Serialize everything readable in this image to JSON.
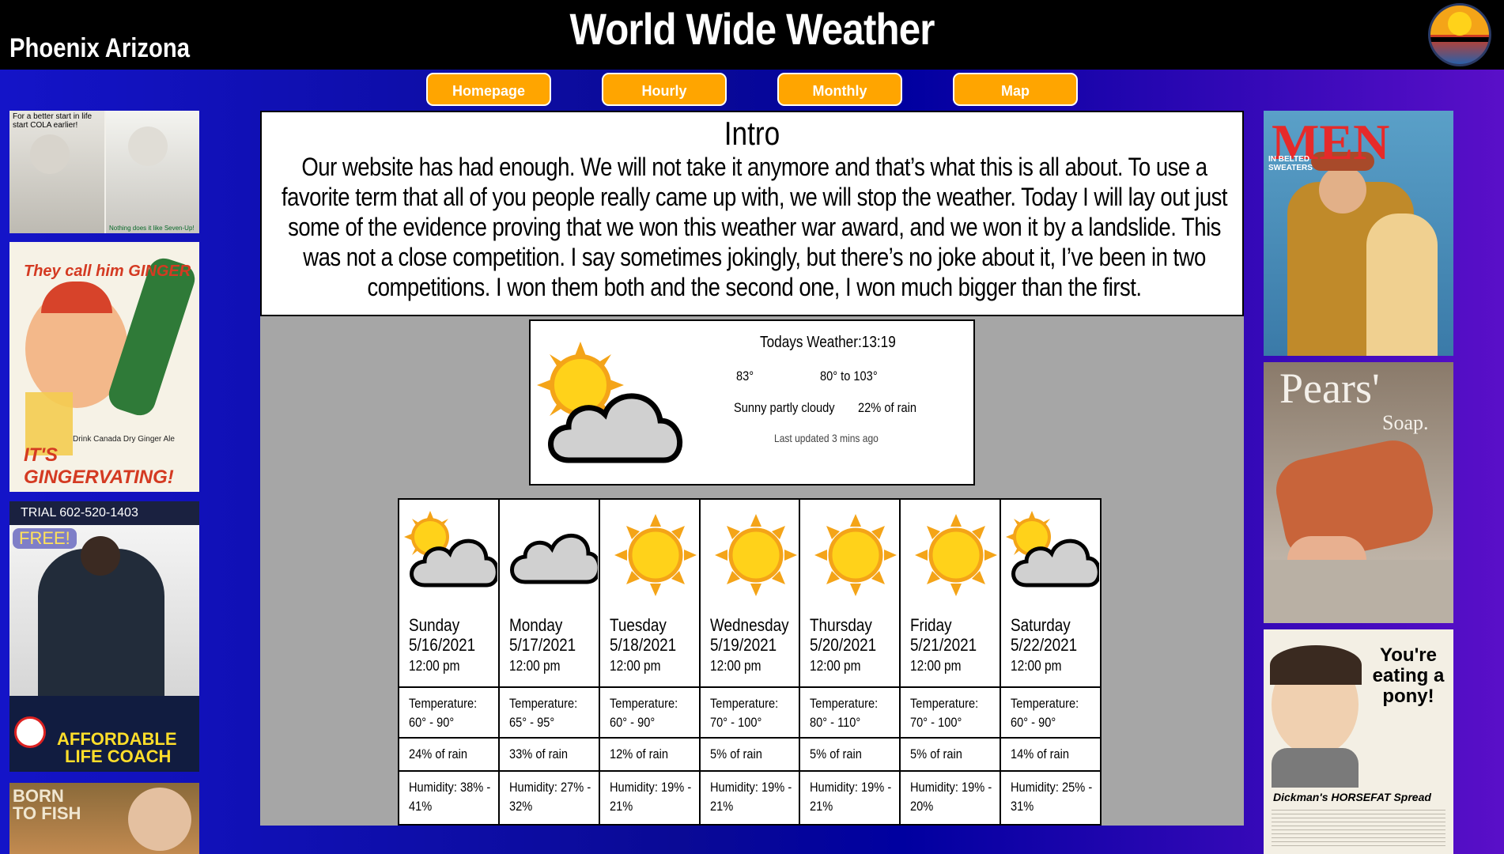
{
  "header": {
    "title": "World Wide Weather",
    "location": "Phoenix Arizona"
  },
  "nav": [
    {
      "label": "Homepage"
    },
    {
      "label": "Hourly"
    },
    {
      "label": "Monthly"
    },
    {
      "label": "Map"
    }
  ],
  "intro": {
    "title": "Intro",
    "text": "Our website has had enough. We will not take it anymore and that’s what this is all about. To use a favorite term that all of you people really came up with, we will stop the weather. Today I will lay out just some of the evidence proving that we won this weather war award, and we won it by a landslide. This was not a close competition. I say sometimes jokingly, but there’s no joke about it, I’ve been in two competitions. I won them both and the second one, I won much bigger than the first."
  },
  "today": {
    "title": "Todays Weather:13:19",
    "current_temp": "83°",
    "range": "80° to 103°",
    "condition": "Sunny partly cloudy",
    "rain": "22% of rain",
    "updated": "Last updated 3 mins ago",
    "icon": "sun-cloud-icon"
  },
  "forecast": [
    {
      "day": "Sunday",
      "date": "5/16/2021",
      "time": "12:00 pm",
      "temp_label": "Temperature:",
      "temp": "60° - 90°",
      "rain": "24% of rain",
      "humidity": "Humidity: 38% - 41%",
      "icon": "sun-cloud-icon"
    },
    {
      "day": "Monday",
      "date": "5/17/2021",
      "time": "12:00 pm",
      "temp_label": "Temperature:",
      "temp": "65° - 95°",
      "rain": "33% of rain",
      "humidity": "Humidity: 27% - 32%",
      "icon": "cloud-icon"
    },
    {
      "day": "Tuesday",
      "date": "5/18/2021",
      "time": "12:00 pm",
      "temp_label": "Temperature:",
      "temp": "60° - 90°",
      "rain": "12% of rain",
      "humidity": "Humidity: 19% - 21%",
      "icon": "sun-icon"
    },
    {
      "day": "Wednesday",
      "date": "5/19/2021",
      "time": "12:00 pm",
      "temp_label": "Temperature:",
      "temp": "70° - 100°",
      "rain": "5% of rain",
      "humidity": "Humidity: 19% - 21%",
      "icon": "sun-icon"
    },
    {
      "day": "Thursday",
      "date": "5/20/2021",
      "time": "12:00 pm",
      "temp_label": "Temperature:",
      "temp": "80° - 110°",
      "rain": "5% of rain",
      "humidity": "Humidity: 19% - 21%",
      "icon": "sun-icon"
    },
    {
      "day": "Friday",
      "date": "5/21/2021",
      "time": "12:00 pm",
      "temp_label": "Temperature:",
      "temp": "70° - 100°",
      "rain": "5% of rain",
      "humidity": "Humidity: 19% - 20%",
      "icon": "sun-icon"
    },
    {
      "day": "Saturday",
      "date": "5/22/2021",
      "time": "12:00 pm",
      "temp_label": "Temperature:",
      "temp": "60° - 90°",
      "rain": "14% of rain",
      "humidity": "Humidity: 25% - 31%",
      "icon": "sun-cloud-icon"
    }
  ],
  "ads": {
    "left": [
      {
        "name": "cola-ad",
        "text": "For a better start in life start COLA earlier!",
        "caption": "Nothing does it like Seven-Up!"
      },
      {
        "name": "ginger-ale-ad",
        "top": "They call him GINGER",
        "bottom": "IT'S GINGERVATING!",
        "sub": "Drink Canada Dry Ginger Ale"
      },
      {
        "name": "life-coach-ad",
        "trial": "TRIAL 602-520-1403",
        "free": "FREE!",
        "title": "AFFORDABLE",
        "title2": "LIFE COACH"
      },
      {
        "name": "born-to-fish-ad",
        "text": "BORN TO FISH"
      }
    ],
    "right": [
      {
        "name": "men-magazine-ad",
        "title": "MEN",
        "sub": "IN BELTED SWEATERS"
      },
      {
        "name": "pears-soap-ad",
        "title": "Pears'",
        "sub": "Soap."
      },
      {
        "name": "horsefat-ad",
        "title": "You're eating a pony!",
        "caption": "Dickman's HORSEFAT Spread"
      }
    ]
  }
}
